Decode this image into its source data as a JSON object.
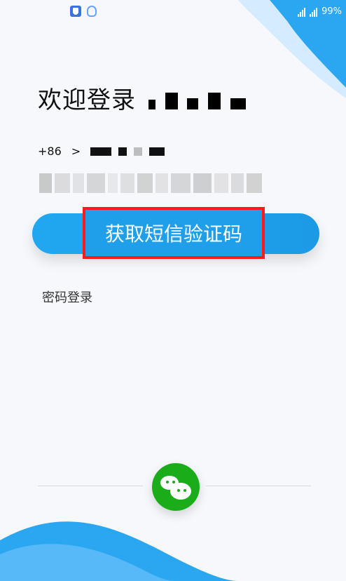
{
  "status_bar": {
    "battery": "99%"
  },
  "page": {
    "title": "欢迎登录",
    "country_code": "+86",
    "country_chevron": ">",
    "primary_button": "获取短信验证码",
    "password_login": "密码登录"
  },
  "social": {
    "icon": "wechat-icon"
  },
  "colors": {
    "primary_blue": "#1f9fe9",
    "highlight_red": "#ff1a1a",
    "wechat_green": "#1aad19"
  }
}
